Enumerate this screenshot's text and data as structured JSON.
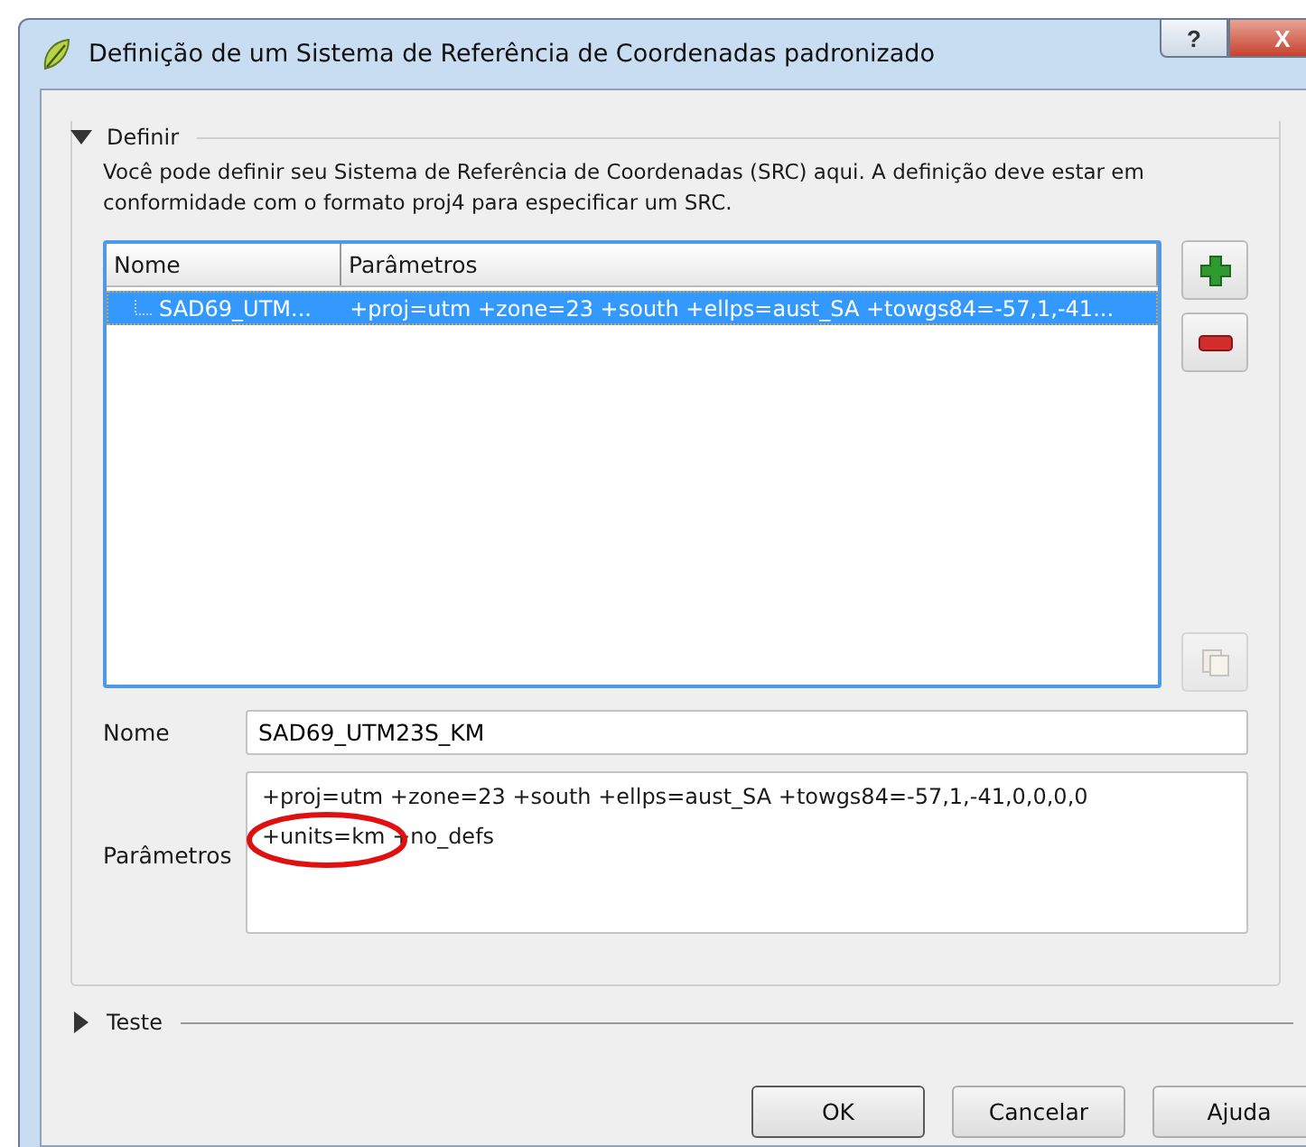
{
  "window": {
    "title": "Definição de um Sistema de Referência de Coordenadas padronizado",
    "help_button": "?",
    "close_button": "X"
  },
  "define_section": {
    "title": "Definir",
    "expanded": true,
    "description": "Você pode definir seu Sistema de Referência de Coordenadas (SRC) aqui. A definição deve estar em conformidade com o formato proj4 para especificar um SRC.",
    "table": {
      "columns": [
        "Nome",
        "Parâmetros"
      ],
      "rows": [
        {
          "name": "SAD69_UTM...",
          "parameters": "+proj=utm +zone=23 +south +ellps=aust_SA +towgs84=-57,1,-41...",
          "selected": true
        }
      ]
    },
    "side_buttons": [
      {
        "kind": "add",
        "disabled": false
      },
      {
        "kind": "remove",
        "disabled": false
      },
      {
        "kind": "copy",
        "disabled": true
      }
    ],
    "name_label": "Nome",
    "name_value": "SAD69_UTM23S_KM",
    "parameters_label": "Parâmetros",
    "parameters_value": "+proj=utm +zone=23 +south +ellps=aust_SA +towgs84=-57,1,-41,0,0,0,0 +units=km +no_defs"
  },
  "test_section": {
    "title": "Teste",
    "expanded": false
  },
  "buttons": [
    {
      "label": "OK",
      "default": true
    },
    {
      "label": "Cancelar",
      "default": false
    },
    {
      "label": "Ajuda",
      "default": false
    }
  ]
}
